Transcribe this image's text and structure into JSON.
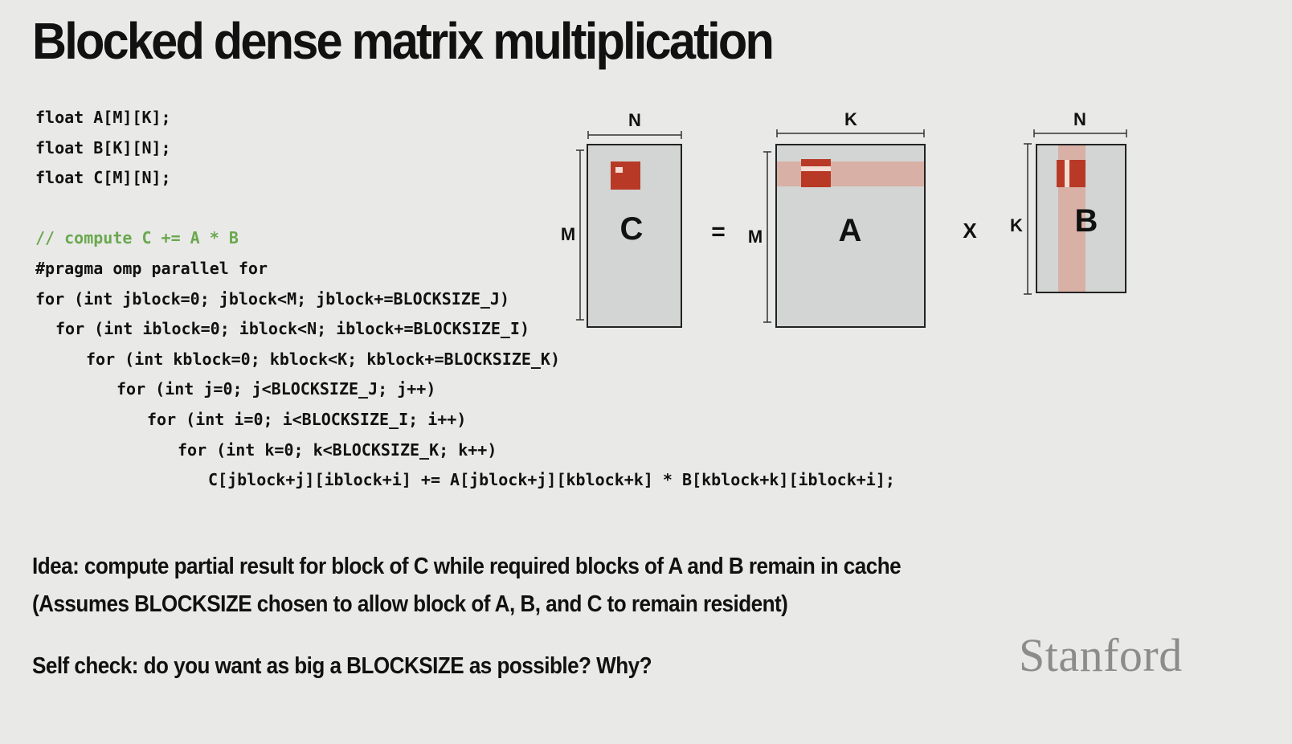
{
  "title": "Blocked dense matrix multiplication",
  "code": {
    "lines": [
      {
        "text": "float A[M][K];",
        "indent": 0,
        "kind": "code"
      },
      {
        "text": "float B[K][N];",
        "indent": 0,
        "kind": "code"
      },
      {
        "text": "float C[M][N];",
        "indent": 0,
        "kind": "code"
      },
      {
        "text": "",
        "indent": 0,
        "kind": "blank"
      },
      {
        "text": "// compute C += A * B",
        "indent": 0,
        "kind": "comment"
      },
      {
        "text": "#pragma omp parallel for",
        "indent": 0,
        "kind": "code"
      },
      {
        "text": "for (int jblock=0; jblock<M; jblock+=BLOCKSIZE_J)",
        "indent": 0,
        "kind": "code"
      },
      {
        "text": "for (int iblock=0; iblock<N; iblock+=BLOCKSIZE_I)",
        "indent": 1,
        "kind": "code"
      },
      {
        "text": "for (int kblock=0; kblock<K; kblock+=BLOCKSIZE_K)",
        "indent": 2,
        "kind": "code"
      },
      {
        "text": "for (int j=0; j<BLOCKSIZE_J; j++)",
        "indent": 3,
        "kind": "code"
      },
      {
        "text": "for (int i=0; i<BLOCKSIZE_I; i++)",
        "indent": 4,
        "kind": "code"
      },
      {
        "text": "for (int k=0; k<BLOCKSIZE_K; k++)",
        "indent": 5,
        "kind": "code"
      },
      {
        "text": "C[jblock+j][iblock+i] += A[jblock+j][kblock+k] * B[kblock+k][iblock+i];",
        "indent": 6,
        "kind": "code"
      }
    ],
    "comment_color": "#6aa84f"
  },
  "diagram": {
    "matrix_c": {
      "label": "C",
      "width_label": "N",
      "height_label": "M"
    },
    "equals": "=",
    "matrix_a": {
      "label": "A",
      "width_label": "K",
      "height_label": "M"
    },
    "times": "X",
    "matrix_b": {
      "label": "B",
      "width_label": "N",
      "height_label": "K"
    },
    "colors": {
      "matrix_fill": "#d2d5d3",
      "highlight_band": "#d8b0a6",
      "block": "#b83a26",
      "block_stripe": "#f2dcd4"
    }
  },
  "idea": {
    "line1": "Idea: compute partial result for block of C while required blocks of A and B remain in cache",
    "line2": "(Assumes BLOCKSIZE chosen to allow block of A, B, and C to remain resident)"
  },
  "self_check": "Self check: do you want as big a BLOCKSIZE as possible? Why?",
  "logo": "Stanford"
}
